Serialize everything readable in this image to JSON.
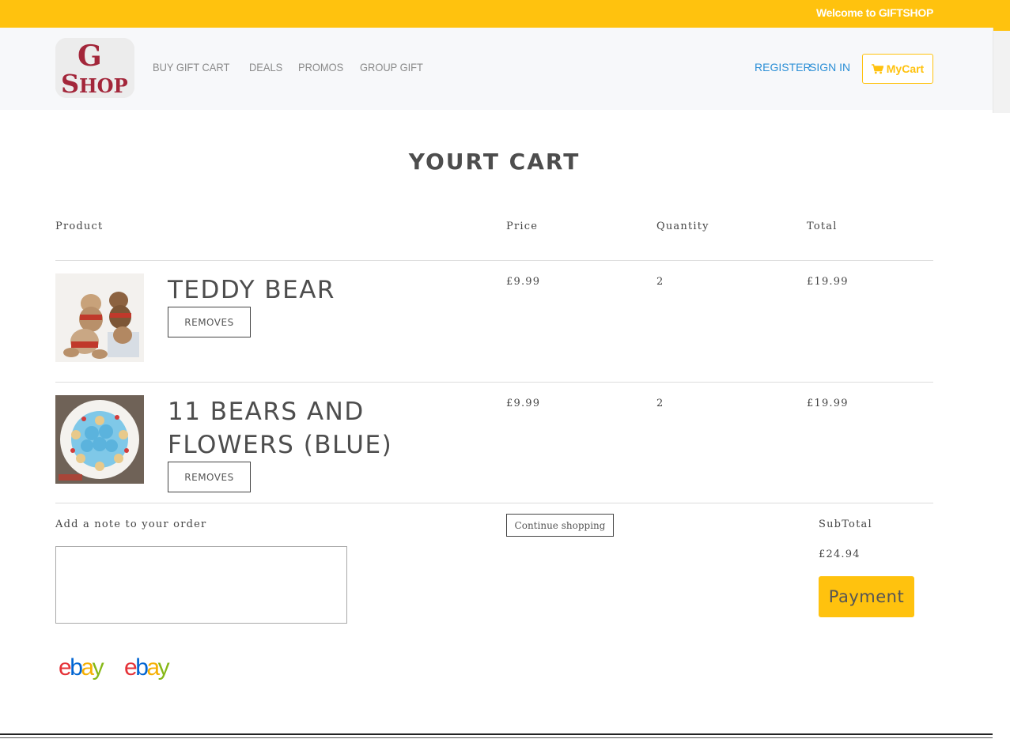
{
  "topbar": {
    "welcome": "Welcome to GIFTSHOP"
  },
  "nav": {
    "logo_alt": "G SHOP",
    "links": [
      "BUY GIFT CART",
      "DEALS",
      "PROMOS",
      "GROUP GIFT"
    ],
    "register": "REGISTER",
    "signin": "SIGN IN",
    "mycart": "MyCart",
    "mycart_icon": "shopping-cart-icon"
  },
  "page": {
    "title": "YOURT CART"
  },
  "table": {
    "headers": {
      "product": "Product",
      "price": "Price",
      "quantity": "Quantity",
      "total": "Total"
    },
    "rows": [
      {
        "name": "TEDDY BEAR",
        "remove": "REMOVES",
        "price": "£9.99",
        "quantity": "2",
        "total": "£19.99"
      },
      {
        "name": "11 BEARS AND FLOWERS (BLUE)",
        "remove": "REMOVES",
        "price": "£9.99",
        "quantity": "2",
        "total": "£19.99"
      }
    ]
  },
  "footer": {
    "note_label": "Add a note to your order",
    "note_value": "",
    "continue": "Continue shopping",
    "subtotal_label": "SubTotal",
    "subtotal_value": "£24.94",
    "payment": "Payment",
    "ebay_logos": [
      "ebay",
      "ebay"
    ]
  },
  "colors": {
    "accent": "#ffc20e",
    "link": "#2b8fd6"
  }
}
